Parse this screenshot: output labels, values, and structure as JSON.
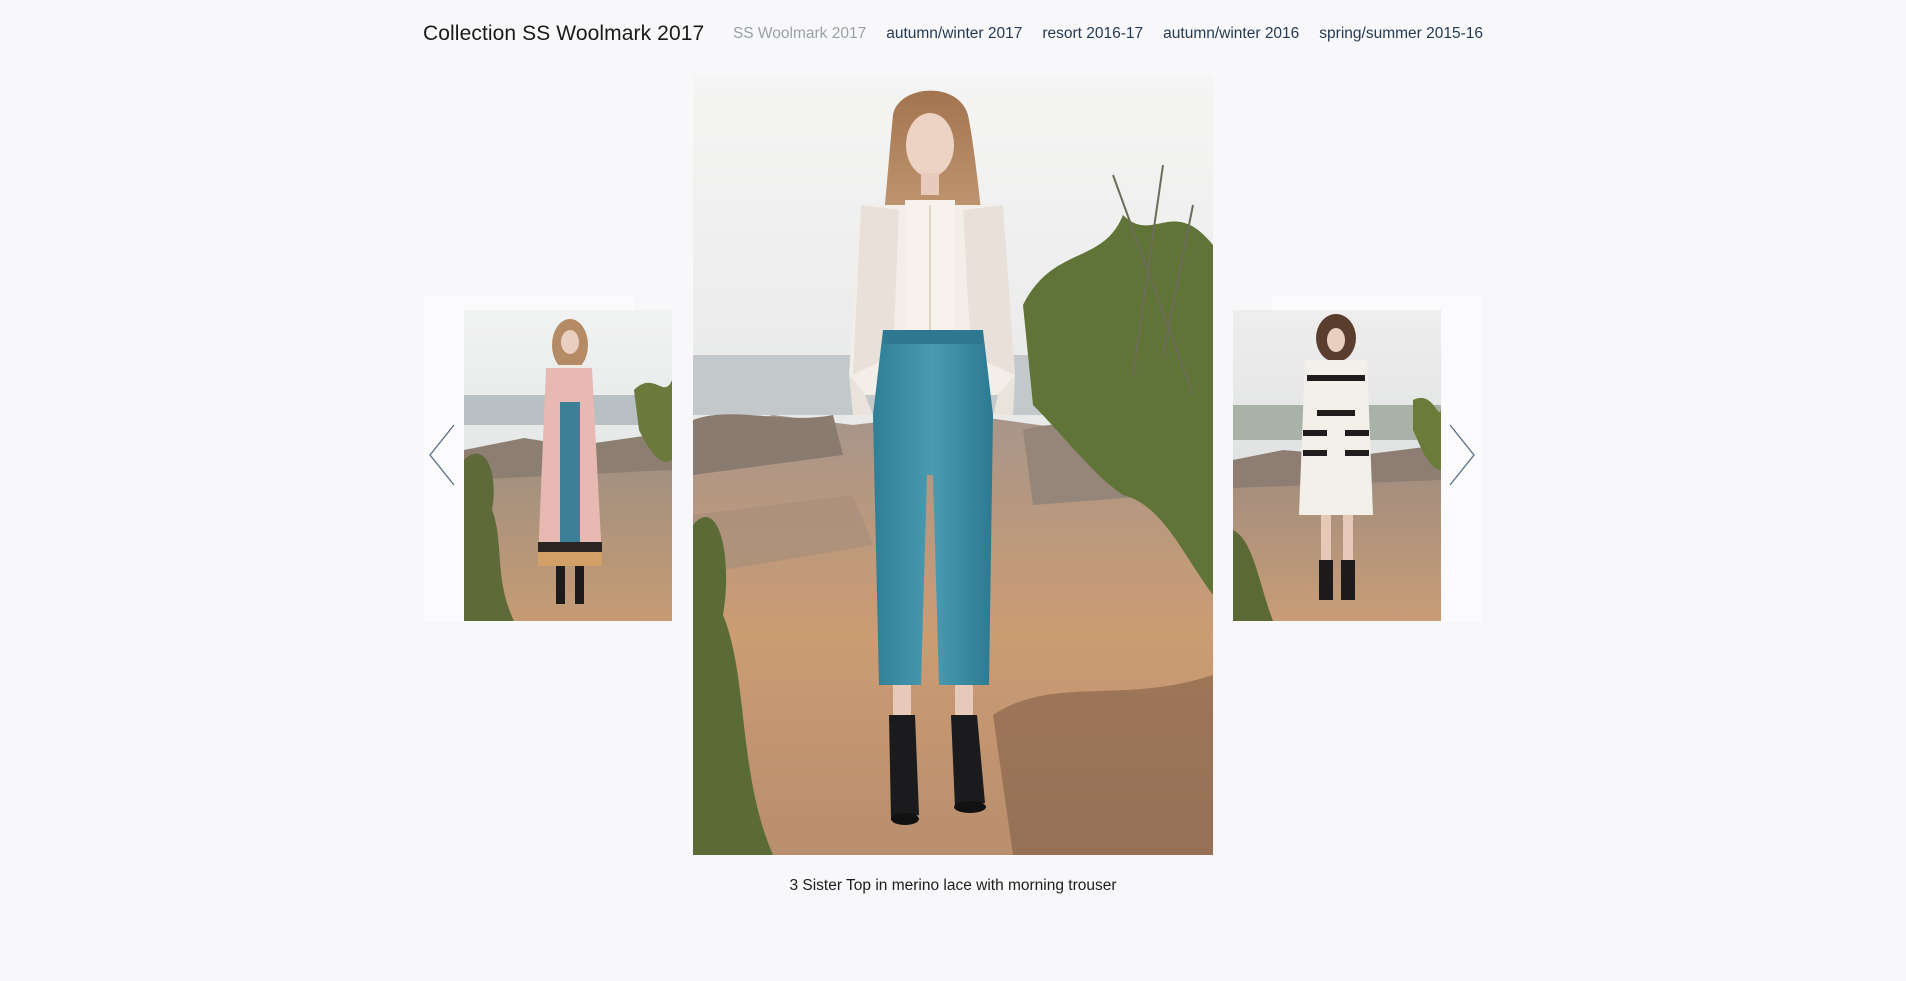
{
  "header": {
    "title": "Collection SS Woolmark 2017",
    "nav": [
      {
        "label": "SS Woolmark 2017",
        "active": true
      },
      {
        "label": "autumn/winter 2017",
        "active": false
      },
      {
        "label": "resort 2016-17",
        "active": false
      },
      {
        "label": "autumn/winter 2016",
        "active": false
      },
      {
        "label": "spring/summer 2015-16",
        "active": false
      }
    ]
  },
  "gallery": {
    "caption": "3 Sister Top in merino lace with morning trouser",
    "prev_icon": "chevron-left-icon",
    "next_icon": "chevron-right-icon"
  },
  "colors": {
    "background": "#f8f8fb",
    "nav_active": "#9aa0a8",
    "nav_link": "#243a52",
    "arrow": "#5a6e82"
  }
}
